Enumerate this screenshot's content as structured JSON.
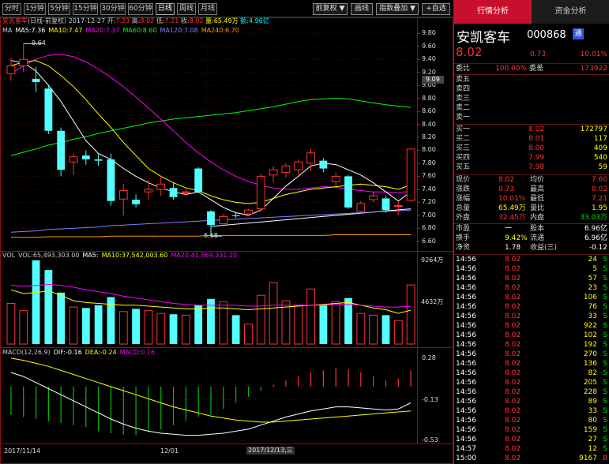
{
  "toolbar": {
    "periods": [
      "分时",
      "1分钟",
      "5分钟",
      "15分钟",
      "30分钟",
      "60分钟",
      "日线",
      "周线",
      "月线"
    ],
    "active_period": 6,
    "right_buttons": [
      "前复权 ▼",
      "画线",
      "指数叠加 ▼",
      "+自选"
    ]
  },
  "header": {
    "name": "安凯客车",
    "desc": "(日线-前复权)",
    "date": "2017-12-27",
    "open_label": "开:",
    "open": "7.23",
    "high_label": "高:",
    "high": "8.02",
    "low_label": "低:",
    "low": "7.21",
    "close_label": "收:",
    "close": "8.02",
    "vol_label": "量:",
    "vol": "65.49万",
    "amt_label": "额:",
    "amt": "4.96亿"
  },
  "ma_legend": [
    {
      "text": "MA",
      "color": "#cccccc"
    },
    {
      "text": "MA5:7.36",
      "color": "#ffffff"
    },
    {
      "text": "MA10:7.47",
      "color": "#ffff00"
    },
    {
      "text": "MA20:7.37",
      "color": "#ff00ff"
    },
    {
      "text": "MA60:8.60",
      "color": "#00ff00"
    },
    {
      "text": "MA120:7.08",
      "color": "#8080ff"
    },
    {
      "text": "MA240:6.70",
      "color": "#ff9900"
    }
  ],
  "vol_legend": [
    {
      "text": "VOL",
      "color": "#cccccc"
    },
    {
      "text": "VOL:65,493,303.00",
      "color": "#cccccc"
    },
    {
      "text": "MA5:",
      "color": "#ffffff"
    },
    {
      "text": "MA10:37,542,003.60",
      "color": "#ffff00"
    },
    {
      "text": "MA20:41,869,331.20",
      "color": "#ff00ff"
    }
  ],
  "macd_legend": [
    {
      "text": "MACD(12,26,9)",
      "color": "#cccccc"
    },
    {
      "text": "DIF:-0.16",
      "color": "#ffffff"
    },
    {
      "text": "DEA:-0.24",
      "color": "#ffff00"
    },
    {
      "text": "MACD:0.16",
      "color": "#ff00ff"
    }
  ],
  "price_axis": {
    "ticks": [
      "9.80",
      "9.60",
      "9.40",
      "9.20",
      "9.00",
      "8.80",
      "8.60",
      "8.40",
      "8.20",
      "8.00",
      "7.80",
      "7.60",
      "7.40",
      "7.20",
      "7.00",
      "6.80",
      "6.60"
    ],
    "current": "9.09"
  },
  "vol_axis": {
    "ticks": [
      "9264万",
      "4632万"
    ]
  },
  "macd_axis": {
    "ticks": [
      "0.28",
      "-0.13",
      "-0.53"
    ]
  },
  "annotations": {
    "max": "9.64",
    "min": "6.68"
  },
  "date_axis": [
    "2017/11/14",
    "12/01",
    "2017/12/13,三"
  ],
  "chart_data": {
    "type": "candlestick",
    "candles": [
      {
        "o": 9.18,
        "h": 9.42,
        "l": 9.07,
        "c": 9.3
      },
      {
        "o": 9.3,
        "h": 9.64,
        "l": 9.2,
        "c": 9.4
      },
      {
        "o": 9.1,
        "h": 9.28,
        "l": 8.9,
        "c": 9.05
      },
      {
        "o": 8.95,
        "h": 9.0,
        "l": 8.25,
        "c": 8.3
      },
      {
        "o": 8.3,
        "h": 8.35,
        "l": 7.6,
        "c": 7.7
      },
      {
        "o": 7.82,
        "h": 7.95,
        "l": 7.62,
        "c": 7.9
      },
      {
        "o": 7.92,
        "h": 8.0,
        "l": 7.78,
        "c": 7.86
      },
      {
        "o": 7.86,
        "h": 7.96,
        "l": 7.76,
        "c": 7.84
      },
      {
        "o": 7.86,
        "h": 7.95,
        "l": 7.15,
        "c": 7.22
      },
      {
        "o": 7.25,
        "h": 7.48,
        "l": 7.0,
        "c": 7.38
      },
      {
        "o": 7.24,
        "h": 7.32,
        "l": 7.12,
        "c": 7.17
      },
      {
        "o": 7.36,
        "h": 7.55,
        "l": 7.24,
        "c": 7.4
      },
      {
        "o": 7.4,
        "h": 7.6,
        "l": 7.3,
        "c": 7.48
      },
      {
        "o": 7.42,
        "h": 7.5,
        "l": 7.24,
        "c": 7.28
      },
      {
        "o": 7.36,
        "h": 7.44,
        "l": 7.32,
        "c": 7.36
      },
      {
        "o": 7.72,
        "h": 7.74,
        "l": 7.34,
        "c": 7.36
      },
      {
        "o": 7.06,
        "h": 7.08,
        "l": 6.68,
        "c": 6.85
      },
      {
        "o": 6.87,
        "h": 7.02,
        "l": 6.84,
        "c": 6.98
      },
      {
        "o": 7.0,
        "h": 7.05,
        "l": 6.96,
        "c": 6.99
      },
      {
        "o": 7.02,
        "h": 7.1,
        "l": 7.0,
        "c": 7.08
      },
      {
        "o": 7.1,
        "h": 7.64,
        "l": 7.06,
        "c": 7.6
      },
      {
        "o": 7.62,
        "h": 7.76,
        "l": 7.5,
        "c": 7.7
      },
      {
        "o": 7.66,
        "h": 7.8,
        "l": 7.58,
        "c": 7.76
      },
      {
        "o": 7.7,
        "h": 7.86,
        "l": 7.62,
        "c": 7.82
      },
      {
        "o": 7.8,
        "h": 8.02,
        "l": 7.68,
        "c": 7.96
      },
      {
        "o": 7.84,
        "h": 7.88,
        "l": 7.66,
        "c": 7.72
      },
      {
        "o": 7.52,
        "h": 7.66,
        "l": 7.44,
        "c": 7.6
      },
      {
        "o": 7.6,
        "h": 7.62,
        "l": 7.1,
        "c": 7.12
      },
      {
        "o": 7.06,
        "h": 7.22,
        "l": 7.04,
        "c": 7.18
      },
      {
        "o": 7.24,
        "h": 7.36,
        "l": 7.2,
        "c": 7.3
      },
      {
        "o": 7.26,
        "h": 7.3,
        "l": 7.04,
        "c": 7.08
      },
      {
        "o": 7.15,
        "h": 7.22,
        "l": 7.0,
        "c": 7.15
      },
      {
        "o": 7.23,
        "h": 8.02,
        "l": 7.21,
        "c": 8.02
      }
    ],
    "ma5": [
      9.38,
      9.35,
      9.22,
      9.0,
      8.75,
      8.45,
      8.15,
      7.95,
      7.86,
      7.72,
      7.6,
      7.5,
      7.42,
      7.36,
      7.32,
      7.36,
      7.24,
      7.12,
      7.04,
      7.0,
      7.08,
      7.26,
      7.45,
      7.6,
      7.76,
      7.8,
      7.78,
      7.7,
      7.62,
      7.5,
      7.36,
      7.22,
      7.36
    ],
    "ma10": [
      9.3,
      9.36,
      9.38,
      9.3,
      9.15,
      8.98,
      8.78,
      8.56,
      8.35,
      8.12,
      7.92,
      7.72,
      7.6,
      7.5,
      7.42,
      7.38,
      7.3,
      7.24,
      7.2,
      7.18,
      7.2,
      7.26,
      7.32,
      7.36,
      7.4,
      7.42,
      7.44,
      7.46,
      7.48,
      7.46,
      7.44,
      7.4,
      7.47
    ],
    "ma20": [
      9.18,
      9.3,
      9.4,
      9.46,
      9.48,
      9.44,
      9.36,
      9.25,
      9.12,
      8.98,
      8.82,
      8.65,
      8.48,
      8.3,
      8.12,
      7.96,
      7.82,
      7.7,
      7.6,
      7.52,
      7.46,
      7.42,
      7.4,
      7.4,
      7.42,
      7.44,
      7.43,
      7.4,
      7.38,
      7.36,
      7.36,
      7.35,
      7.37
    ],
    "ma60": [
      7.92,
      7.97,
      8.02,
      8.08,
      8.12,
      8.17,
      8.21,
      8.26,
      8.3,
      8.34,
      8.38,
      8.42,
      8.45,
      8.48,
      8.5,
      8.52,
      8.54,
      8.56,
      8.58,
      8.61,
      8.64,
      8.67,
      8.71,
      8.75,
      8.78,
      8.79,
      8.8,
      8.79,
      8.76,
      8.73,
      8.7,
      8.68,
      8.66
    ],
    "ma120": [
      6.74,
      6.75,
      6.76,
      6.78,
      6.79,
      6.8,
      6.81,
      6.82,
      6.84,
      6.85,
      6.86,
      6.87,
      6.88,
      6.89,
      6.9,
      6.91,
      6.92,
      6.93,
      6.94,
      6.95,
      6.96,
      6.97,
      6.98,
      6.99,
      7.0,
      7.01,
      7.02,
      7.03,
      7.04,
      7.05,
      7.06,
      7.07,
      7.08
    ],
    "ma240": [
      6.66,
      6.66,
      6.66,
      6.67,
      6.67,
      6.67,
      6.67,
      6.67,
      6.68,
      6.68,
      6.68,
      6.68,
      6.68,
      6.68,
      6.68,
      6.68,
      6.69,
      6.69,
      6.69,
      6.69,
      6.69,
      6.69,
      6.69,
      6.69,
      6.69,
      6.69,
      6.7,
      6.7,
      6.7,
      6.7,
      6.7,
      6.7,
      6.7
    ],
    "volume": [
      4500,
      3700,
      9264,
      8200,
      5700,
      4100,
      4000,
      4300,
      5200,
      3600,
      3900,
      3700,
      3400,
      3300,
      3200,
      4300,
      5000,
      4700,
      3200,
      2200,
      5400,
      6800,
      4800,
      4300,
      6100,
      4400,
      4700,
      5100,
      3400,
      3200,
      3200,
      2600,
      6550
    ],
    "vol_ma10": [
      6000,
      5600,
      5700,
      5900,
      5400,
      4800,
      4600,
      4500,
      4400,
      4300,
      4300,
      4200,
      4100,
      4000,
      3900,
      3900,
      4000,
      4000,
      3900,
      3800,
      3900,
      4000,
      4100,
      4200,
      4300,
      4400,
      4500,
      4600,
      4300,
      4000,
      3800,
      3400,
      3750
    ],
    "vol_ma20": [
      6500,
      6400,
      6500,
      6600,
      6500,
      6300,
      6000,
      5800,
      5600,
      5300,
      5100,
      4900,
      4700,
      4500,
      4400,
      4300,
      4300,
      4300,
      4300,
      4200,
      4200,
      4300,
      4300,
      4300,
      4300,
      4300,
      4400,
      4400,
      4300,
      4200,
      4100,
      4100,
      4190
    ],
    "macd_bar": [
      -0.28,
      -0.3,
      -0.32,
      -0.34,
      -0.36,
      -0.38,
      -0.4,
      -0.44,
      -0.46,
      -0.47,
      -0.48,
      -0.45,
      -0.42,
      -0.38,
      -0.34,
      -0.3,
      -0.28,
      -0.22,
      -0.16,
      -0.1,
      -0.04,
      0.02,
      0.06,
      0.1,
      0.14,
      0.16,
      0.18,
      0.17,
      0.14,
      0.1,
      0.06,
      0.08,
      0.16
    ],
    "dif": [
      0.14,
      0.1,
      0.04,
      -0.02,
      -0.08,
      -0.14,
      -0.2,
      -0.26,
      -0.32,
      -0.37,
      -0.41,
      -0.44,
      -0.46,
      -0.47,
      -0.48,
      -0.48,
      -0.47,
      -0.46,
      -0.44,
      -0.42,
      -0.38,
      -0.34,
      -0.3,
      -0.27,
      -0.24,
      -0.22,
      -0.2,
      -0.2,
      -0.21,
      -0.22,
      -0.23,
      -0.22,
      -0.16
    ],
    "dea": [
      0.28,
      0.26,
      0.23,
      0.2,
      0.16,
      0.12,
      0.08,
      0.04,
      0.0,
      -0.04,
      -0.08,
      -0.12,
      -0.16,
      -0.2,
      -0.23,
      -0.26,
      -0.29,
      -0.31,
      -0.33,
      -0.34,
      -0.35,
      -0.35,
      -0.34,
      -0.33,
      -0.32,
      -0.31,
      -0.3,
      -0.29,
      -0.28,
      -0.27,
      -0.26,
      -0.25,
      -0.24
    ],
    "price_range": [
      6.5,
      9.9
    ],
    "vol_range": [
      0,
      9264
    ],
    "macd_range": [
      -0.53,
      0.28
    ]
  },
  "quote": {
    "name": "安凯客车",
    "code": "000868",
    "badge": "通",
    "price": "8.02",
    "change": "0.73",
    "pct": "10.01%",
    "weibi_label": "委比",
    "weibi": "100.00%",
    "weicha_label": "委差",
    "weicha": "173922",
    "asks": [
      {
        "label": "卖五",
        "price": "",
        "vol": ""
      },
      {
        "label": "卖四",
        "price": "",
        "vol": ""
      },
      {
        "label": "卖三",
        "price": "",
        "vol": ""
      },
      {
        "label": "卖二",
        "price": "",
        "vol": ""
      },
      {
        "label": "卖一",
        "price": "",
        "vol": ""
      }
    ],
    "bids": [
      {
        "label": "买一",
        "price": "8.02",
        "vol": "172797"
      },
      {
        "label": "买二",
        "price": "8.01",
        "vol": "117"
      },
      {
        "label": "买三",
        "price": "8.00",
        "vol": "409"
      },
      {
        "label": "买四",
        "price": "7.99",
        "vol": "540"
      },
      {
        "label": "买五",
        "price": "7.98",
        "vol": "59"
      }
    ],
    "stats": [
      {
        "l1": "现价",
        "v1": "8.02",
        "c1": "red",
        "l2": "均价",
        "v2": "7.60",
        "c2": "red"
      },
      {
        "l1": "涨跌",
        "v1": "0.73",
        "c1": "red",
        "l2": "最高",
        "v2": "8.02",
        "c2": "red"
      },
      {
        "l1": "涨幅",
        "v1": "10.01%",
        "c1": "red",
        "l2": "最低",
        "v2": "7.21",
        "c2": "red"
      },
      {
        "l1": "总量",
        "v1": "65.49万",
        "c1": "yellow",
        "l2": "量比",
        "v2": "1.95",
        "c2": "yellow"
      },
      {
        "l1": "外盘",
        "v1": "32.45万",
        "c1": "red",
        "l2": "内盘",
        "v2": "33.03万",
        "c2": "green"
      }
    ],
    "stats2": [
      {
        "l1": "市盈",
        "v1": "一",
        "l2": "股本",
        "v2": "6.96亿"
      },
      {
        "l1": "换手",
        "v1": "9.42%",
        "l2": "流通",
        "v2": "6.96亿"
      },
      {
        "l1": "净资",
        "v1": "1.78",
        "l2": "收益(三)",
        "v2": "-0.12"
      }
    ],
    "tabs": [
      "行情分析",
      "资金分析"
    ]
  },
  "ticks": [
    {
      "t": "14:56",
      "p": "8.02",
      "v": "24",
      "d": "S"
    },
    {
      "t": "14:56",
      "p": "8.02",
      "v": "5",
      "d": "S"
    },
    {
      "t": "14:56",
      "p": "8.02",
      "v": "57",
      "d": "S"
    },
    {
      "t": "14:56",
      "p": "8.02",
      "v": "23",
      "d": "S"
    },
    {
      "t": "14:56",
      "p": "8.02",
      "v": "106",
      "d": "S"
    },
    {
      "t": "14:56",
      "p": "8.02",
      "v": "76",
      "d": "S"
    },
    {
      "t": "14:56",
      "p": "8.02",
      "v": "33",
      "d": "S"
    },
    {
      "t": "14:56",
      "p": "8.02",
      "v": "922",
      "d": "S"
    },
    {
      "t": "14:56",
      "p": "8.02",
      "v": "102",
      "d": "S"
    },
    {
      "t": "14:56",
      "p": "8.02",
      "v": "192",
      "d": "S"
    },
    {
      "t": "14:56",
      "p": "8.02",
      "v": "270",
      "d": "S"
    },
    {
      "t": "14:56",
      "p": "8.02",
      "v": "136",
      "d": "S"
    },
    {
      "t": "14:56",
      "p": "8.02",
      "v": "82",
      "d": "S"
    },
    {
      "t": "14:56",
      "p": "8.02",
      "v": "205",
      "d": "S"
    },
    {
      "t": "14:56",
      "p": "8.02",
      "v": "228",
      "d": "S"
    },
    {
      "t": "14:56",
      "p": "8.02",
      "v": "89",
      "d": "S"
    },
    {
      "t": "14:56",
      "p": "8.02",
      "v": "33",
      "d": "S"
    },
    {
      "t": "14:56",
      "p": "8.02",
      "v": "80",
      "d": "S"
    },
    {
      "t": "14:56",
      "p": "8.02",
      "v": "159",
      "d": "S"
    },
    {
      "t": "14:56",
      "p": "8.02",
      "v": "27",
      "d": "S"
    },
    {
      "t": "14:57",
      "p": "8.02",
      "v": "12",
      "d": "S"
    },
    {
      "t": "15:00",
      "p": "8.02",
      "v": "9167",
      "d": "B"
    }
  ]
}
